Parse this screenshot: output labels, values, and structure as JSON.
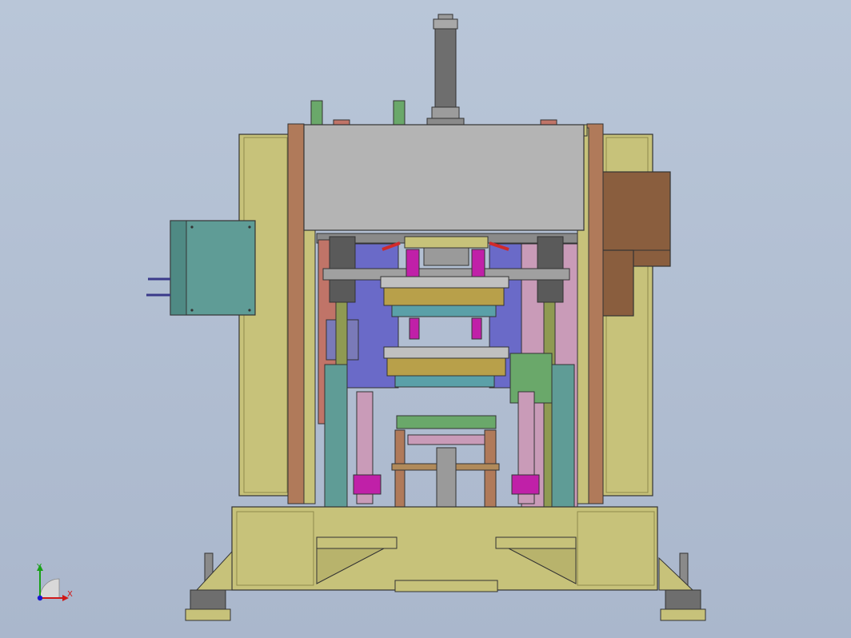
{
  "viewport": {
    "background_top": "#b9c6d8",
    "background_bottom": "#aab7cc"
  },
  "palette": {
    "frame_olive": "#c7c27a",
    "frame_olive_dark": "#8f8a4c",
    "gray_plate": "#b4b4b4",
    "slate_column": "#6d6d6d",
    "teal_box": "#5f9c96",
    "brown_box": "#8a5e3e",
    "magenta": "#c020a8",
    "pink_panel": "#c99bb8",
    "salmon": "#c07468",
    "green_block": "#6aa86a",
    "blue_panel": "#6a6ac8"
  },
  "triad": {
    "x_label": "X",
    "y_label": "Y",
    "x_color": "#d01818",
    "y_color": "#18a018",
    "z_color": "#1818d0"
  }
}
